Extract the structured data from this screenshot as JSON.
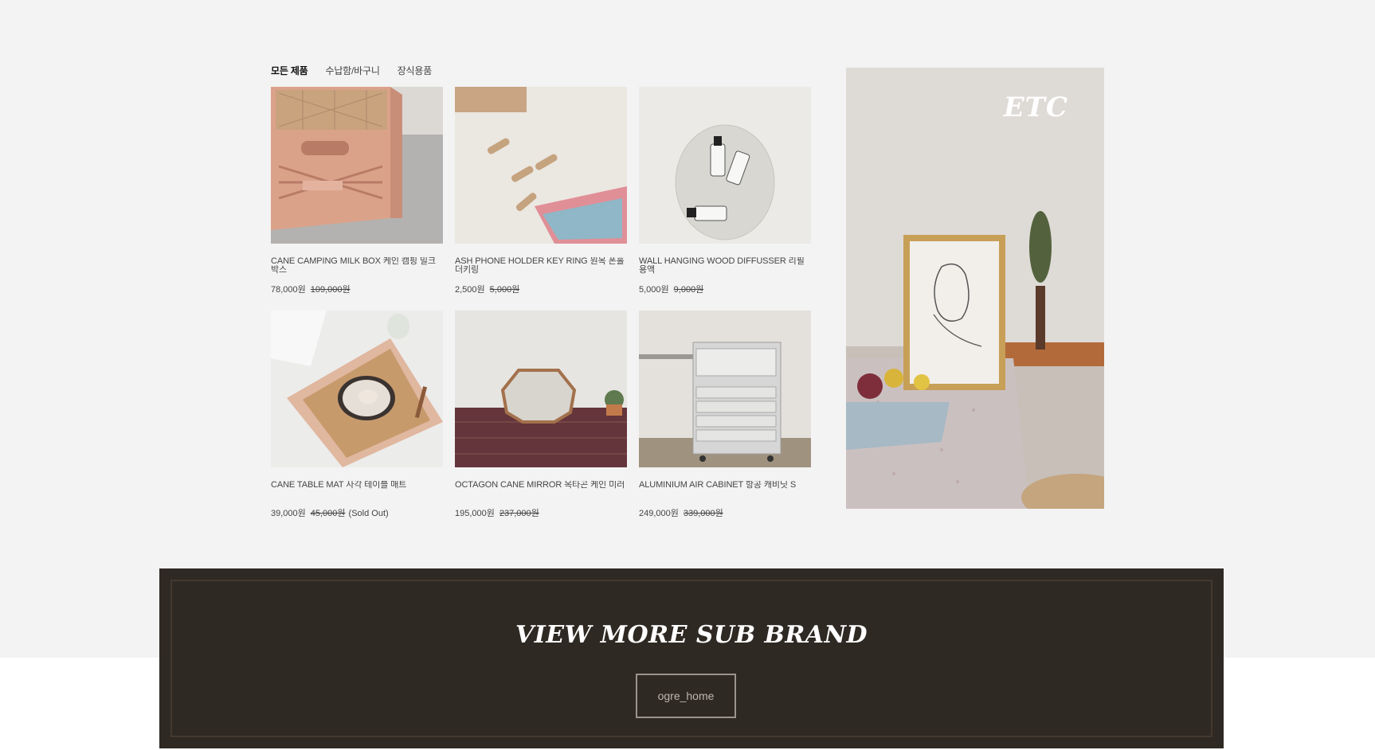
{
  "tabs": [
    "모든 제품",
    "수납함/바구니",
    "장식용품"
  ],
  "products": [
    {
      "name": "CANE CAMPING MILK BOX 케인 캠핑 밀크박스",
      "price": "78,000원",
      "old_price": "109,000원",
      "note": ""
    },
    {
      "name": "ASH PHONE HOLDER KEY RING 원목 폰홀더키링",
      "price": "2,500원",
      "old_price": "5,000원",
      "note": ""
    },
    {
      "name": "WALL HANGING WOOD DIFFUSSER 리필용액",
      "price": "5,000원",
      "old_price": "9,000원",
      "note": ""
    },
    {
      "name": "CANE TABLE MAT 사각 테이블 매트",
      "price": "39,000원",
      "old_price": "45,000원",
      "note": "(Sold Out)"
    },
    {
      "name": "OCTAGON CANE MIRROR 옥타곤 케인 미러",
      "price": "195,000원",
      "old_price": "237,000원",
      "note": ""
    },
    {
      "name": "ALUMINIUM AIR CABINET 항공 캐비닛 S",
      "price": "249,000원",
      "old_price": "339,000원",
      "note": ""
    }
  ],
  "banner": {
    "title": "ETC"
  },
  "brand": {
    "title": "VIEW MORE SUB BRAND",
    "button": "ogre_home"
  }
}
